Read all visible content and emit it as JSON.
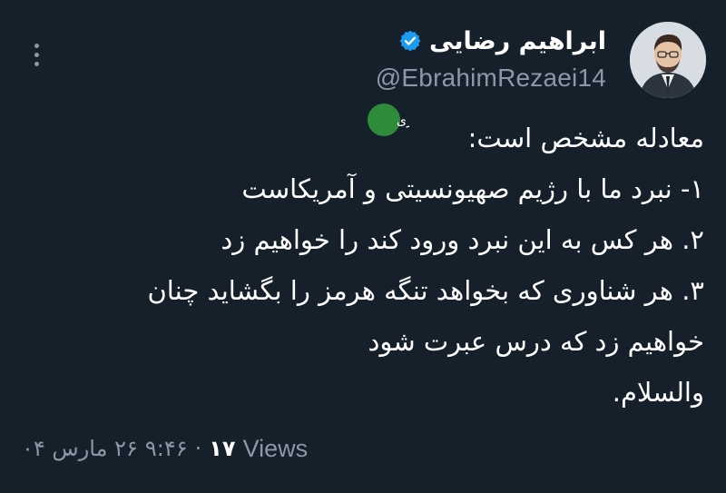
{
  "tweet": {
    "author": {
      "display_name": "ابراهیم رضایی",
      "handle": "@EbrahimRezaei14",
      "verified": true,
      "avatar_icon": "portrait-avatar"
    },
    "watermark_text": "خبرفوری",
    "lines": [
      "معادله مشخص است:",
      "۱- نبرد ما با رژیم صهیونسیتی و آمریکاست",
      "۲. هر کس به این نبرد ورود کند را خواهیم زد",
      "۳. هر شناوری که بخواهد تنگه هرمز را بگشاید چنان",
      "خواهیم زد که درس عبرت شود",
      "والسلام."
    ],
    "meta": {
      "date": "۲۶ مارس ۰۴",
      "time": "۹:۴۶",
      "separator": "·",
      "views_count": "۱۷",
      "views_label": "Views"
    }
  },
  "colors": {
    "background": "#15202b",
    "text": "#ffffff",
    "secondary": "#8b98a5",
    "verified": "#1d9bf0",
    "watermark": "#2e8b3a"
  }
}
